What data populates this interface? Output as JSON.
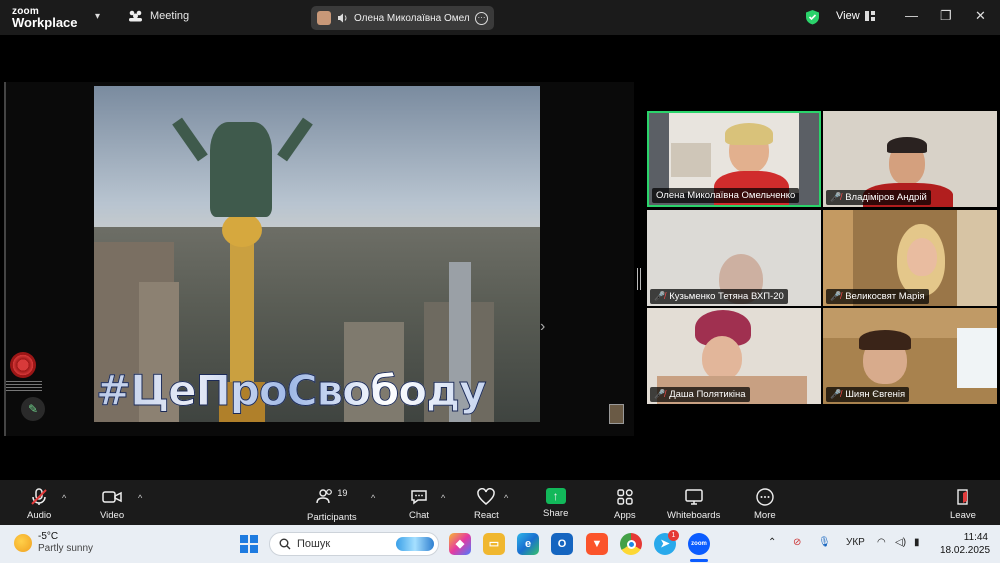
{
  "app": {
    "logo_line1": "zoom",
    "logo_line2": "Workplace",
    "meeting_label": "Meeting",
    "active_speaker": "Олена Миколаївна Омельч",
    "view_label": "View"
  },
  "shared_content": {
    "hashtag": "#ЦеПроСвободу"
  },
  "participants": [
    {
      "name": "Олена Миколаївна Омельченко",
      "muted": false,
      "active": true
    },
    {
      "name": "Владіміров Андрій",
      "muted": true,
      "active": false
    },
    {
      "name": "Кузьменко Тетяна ВХП-20",
      "muted": true,
      "active": false
    },
    {
      "name": "Великосвят Марія",
      "muted": true,
      "active": false
    },
    {
      "name": "Даша Полятикіна",
      "muted": true,
      "active": false
    },
    {
      "name": "Шиян Євгенія",
      "muted": true,
      "active": false
    }
  ],
  "toolbar": {
    "audio": "Audio",
    "video": "Video",
    "participants": "Participants",
    "participants_count": "19",
    "chat": "Chat",
    "react": "React",
    "share": "Share",
    "apps": "Apps",
    "whiteboards": "Whiteboards",
    "more": "More",
    "leave": "Leave"
  },
  "taskbar": {
    "temperature": "-5°C",
    "weather": "Partly sunny",
    "search_placeholder": "Пошук",
    "language": "УКР",
    "time": "11:44",
    "date": "18.02.2025",
    "telegram_badge": "1"
  },
  "colors": {
    "active_border": "#2bd36b",
    "share_green": "#12b85a",
    "leave_red": "#e23c3c",
    "muted_red": "#ff4d4d"
  }
}
